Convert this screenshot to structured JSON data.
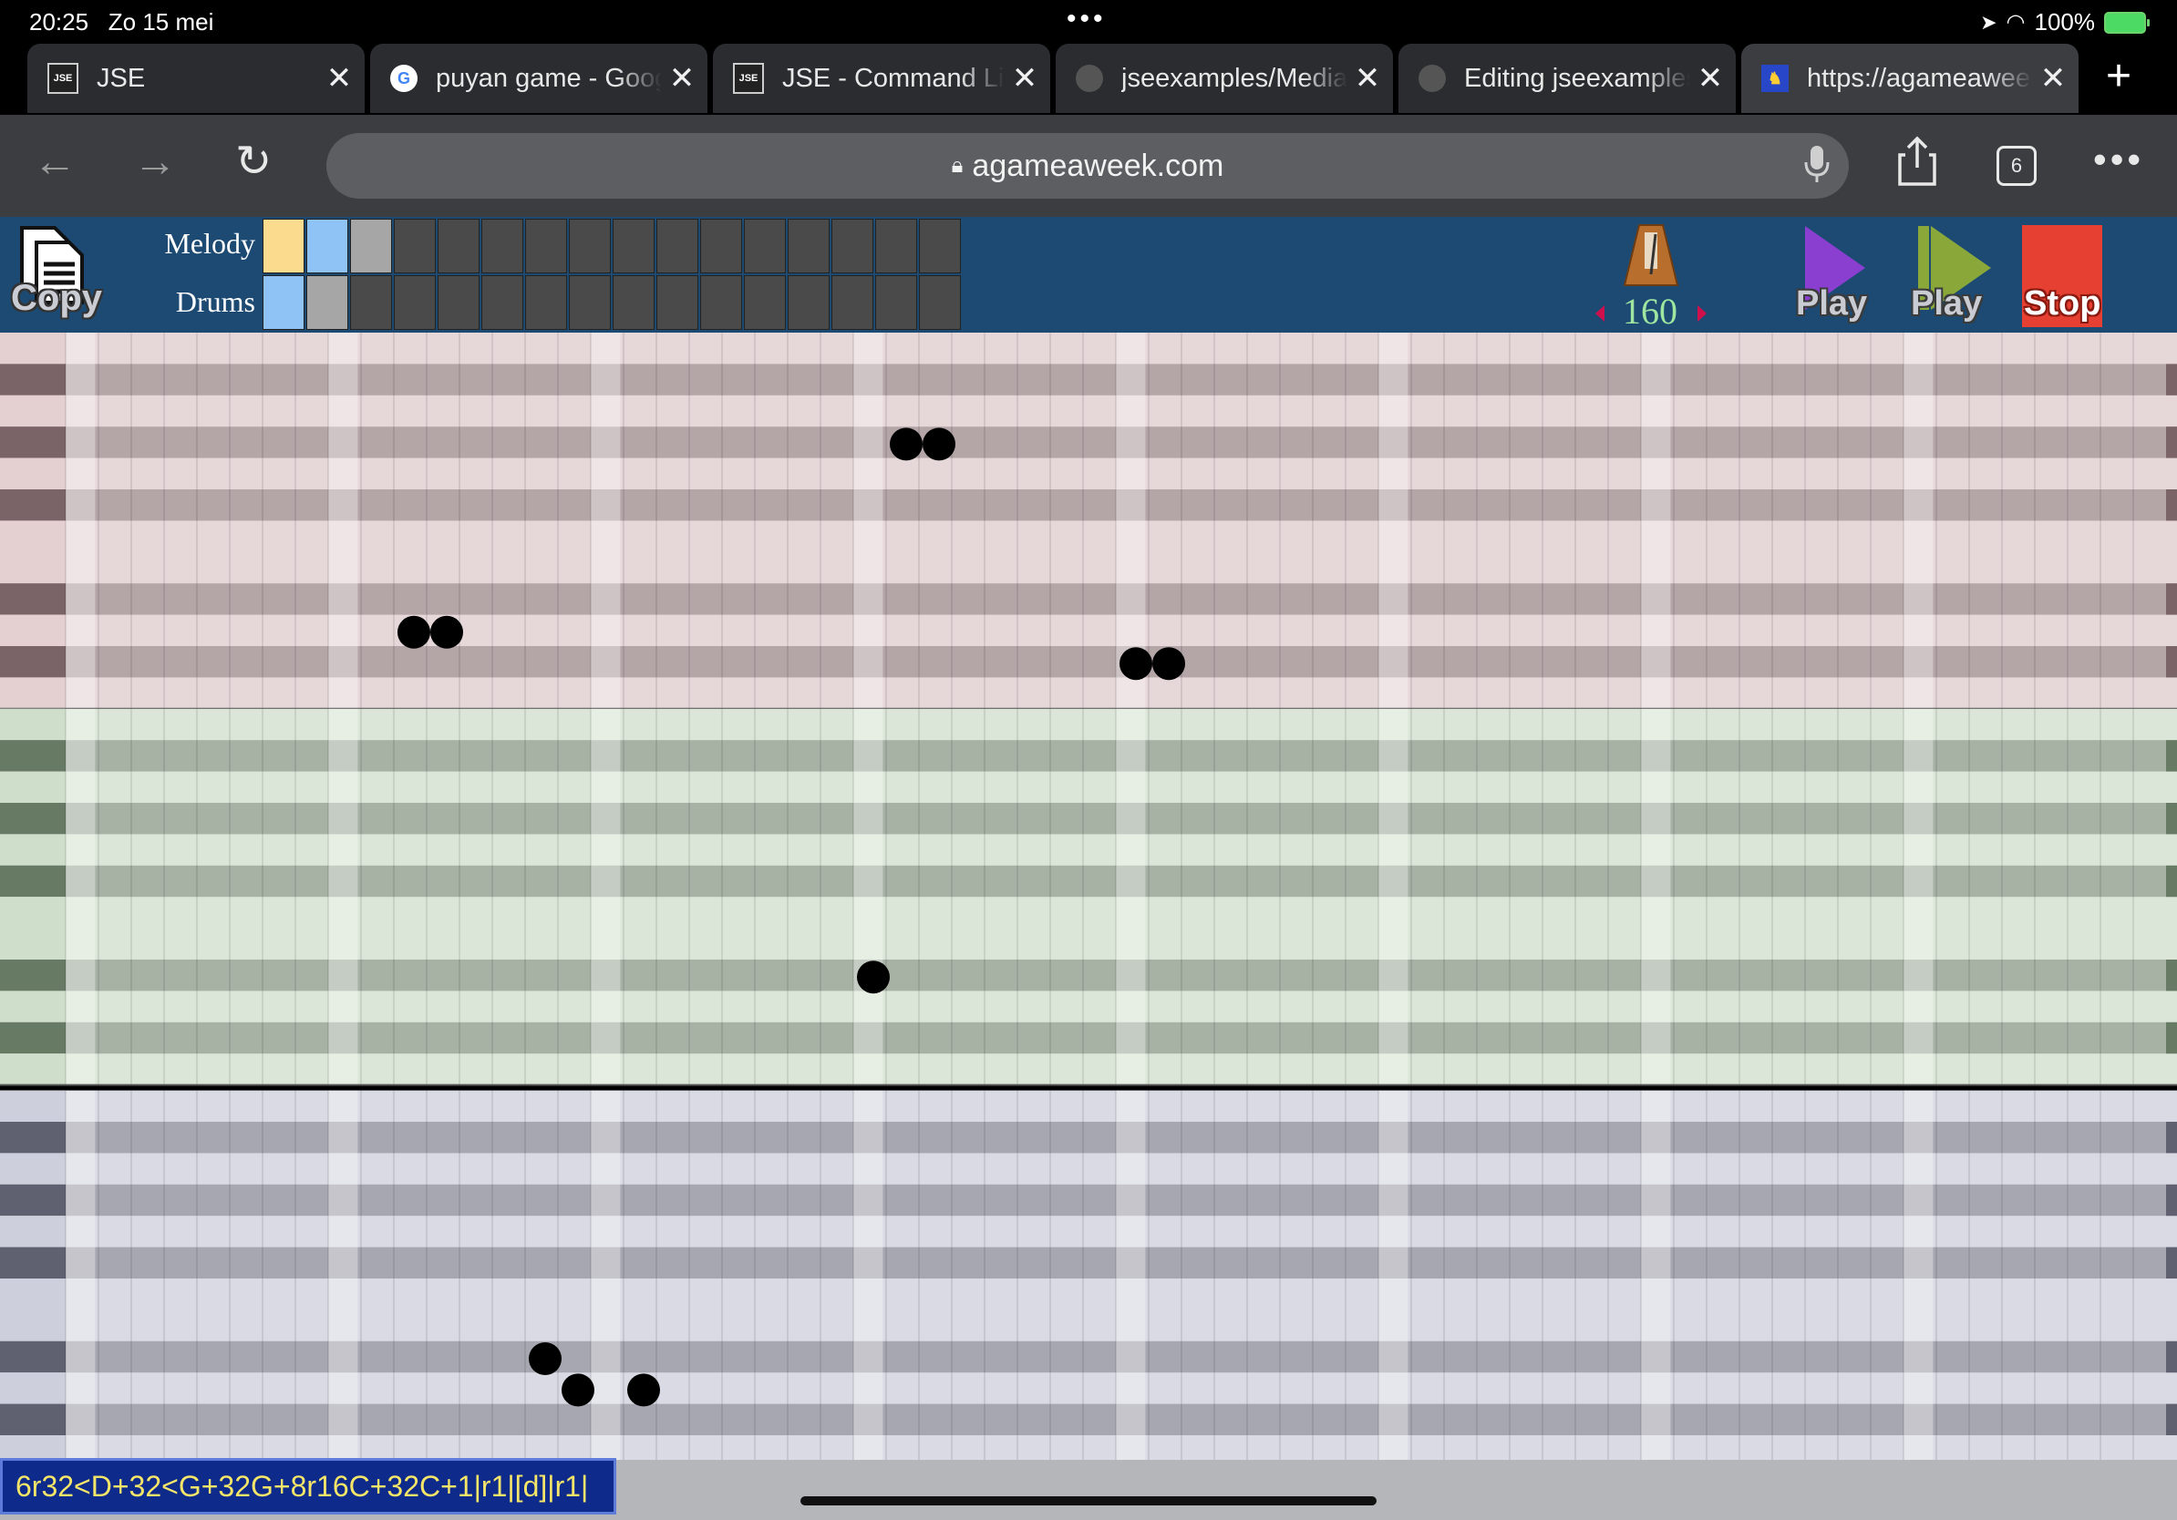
{
  "status_bar": {
    "time": "20:25",
    "date": "Zo 15 mei",
    "battery": "100%"
  },
  "tabs": [
    {
      "title": "JSE",
      "favicon": "jse-icon",
      "active": false
    },
    {
      "title": "puyan game - Google",
      "favicon": "google-icon",
      "active": false
    },
    {
      "title": "JSE - Command Line",
      "favicon": "jse-icon",
      "active": false
    },
    {
      "title": "jseexamples/Media",
      "favicon": "github-icon",
      "active": false
    },
    {
      "title": "Editing jseexamples",
      "favicon": "github-icon",
      "active": false
    },
    {
      "title": "https://agameaweek.com",
      "favicon": "agameaweek-icon",
      "active": true
    }
  ],
  "address_bar": {
    "url": "agameaweek.com",
    "tab_count": "6"
  },
  "app": {
    "copy_label": "Copy",
    "melody_label": "Melody",
    "drums_label": "Drums",
    "melody_patterns": [
      "#fbdc8e",
      "#8fc3f5",
      "#a6a6a6",
      "#4a4a4a",
      "#4a4a4a",
      "#4a4a4a",
      "#4a4a4a",
      "#4a4a4a",
      "#4a4a4a",
      "#4a4a4a",
      "#4a4a4a",
      "#4a4a4a",
      "#4a4a4a",
      "#4a4a4a",
      "#4a4a4a",
      "#4a4a4a"
    ],
    "drums_patterns": [
      "#8fc3f5",
      "#a6a6a6",
      "#4a4a4a",
      "#4a4a4a",
      "#4a4a4a",
      "#4a4a4a",
      "#4a4a4a",
      "#4a4a4a",
      "#4a4a4a",
      "#4a4a4a",
      "#4a4a4a",
      "#4a4a4a",
      "#4a4a4a",
      "#4a4a4a",
      "#4a4a4a",
      "#4a4a4a"
    ],
    "tempo": "160",
    "play_label": "Play",
    "play2_label": "Play",
    "stop_label": "Stop",
    "colors": {
      "header": "#1c4a73",
      "play": "#8a3fd1",
      "play2": "#8aa83a",
      "stop": "#e64032"
    }
  },
  "sequencer": {
    "columns": 64,
    "sections": [
      {
        "name": "melody-high",
        "rows": 12,
        "colors": {
          "light": "#e6d8d9",
          "dark": "#b4a5a7",
          "key": "#7b6467",
          "key_light": "#e4cfd1"
        }
      },
      {
        "name": "melody-low",
        "rows": 12,
        "colors": {
          "light": "#dbe6d8",
          "dark": "#a7b1a4",
          "key": "#677a64",
          "key_light": "#cfdeca"
        }
      },
      {
        "name": "drums",
        "rows": 12,
        "colors": {
          "light": "#d9dae3",
          "dark": "#a6a7b0",
          "key": "#5f6070",
          "key_light": "#cdcfdc"
        }
      }
    ],
    "notes": [
      {
        "section": 0,
        "row": 3,
        "col": 25,
        "length": 2
      },
      {
        "section": 0,
        "row": 9,
        "col": 10,
        "length": 2
      },
      {
        "section": 0,
        "row": 10,
        "col": 32,
        "length": 2
      },
      {
        "section": 1,
        "row": 8,
        "col": 24,
        "length": 1
      },
      {
        "section": 2,
        "row": 8,
        "col": 14,
        "length": 1
      },
      {
        "section": 2,
        "row": 9,
        "col": 15,
        "length": 1
      },
      {
        "section": 2,
        "row": 9,
        "col": 17,
        "length": 1
      }
    ]
  },
  "code_output": "6r32<D+32<G+32G+8r16C+32C+1|r1|[d]|r1|"
}
